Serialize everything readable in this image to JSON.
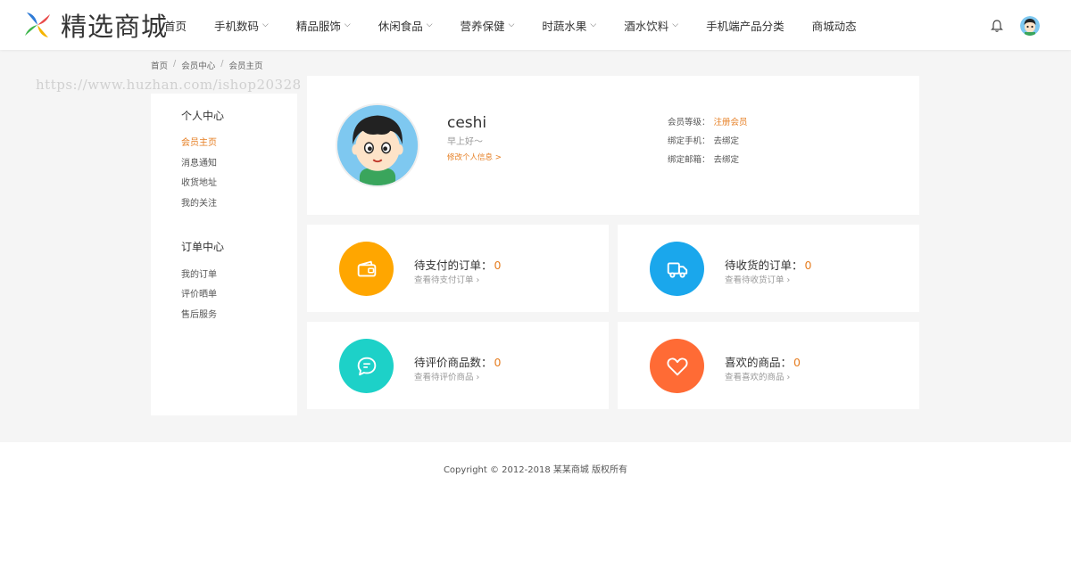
{
  "header": {
    "logo_text": "精选商城",
    "nav": [
      {
        "label": "首页",
        "has_dropdown": false
      },
      {
        "label": "手机数码",
        "has_dropdown": true
      },
      {
        "label": "精品服饰",
        "has_dropdown": true
      },
      {
        "label": "休闲食品",
        "has_dropdown": true
      },
      {
        "label": "营养保健",
        "has_dropdown": true
      },
      {
        "label": "时蔬水果",
        "has_dropdown": true
      },
      {
        "label": "酒水饮料",
        "has_dropdown": true
      },
      {
        "label": "手机端产品分类",
        "has_dropdown": false
      },
      {
        "label": "商城动态",
        "has_dropdown": false
      }
    ],
    "chevron": "⌵"
  },
  "breadcrumb": [
    "首页",
    "会员中心",
    "会员主页"
  ],
  "breadcrumb_sep": "/",
  "watermark": "https://www.huzhan.com/ishop20328",
  "sidebar": {
    "groups": [
      {
        "title": "个人中心",
        "items": [
          "会员主页",
          "消息通知",
          "收货地址",
          "我的关注"
        ]
      },
      {
        "title": "订单中心",
        "items": [
          "我的订单",
          "评价晒单",
          "售后服务"
        ]
      }
    ]
  },
  "profile": {
    "name": "ceshi",
    "greeting": "早上好～",
    "edit_link": "修改个人信息 >",
    "level_label": "会员等级：",
    "level_value": "注册会员",
    "phone_label": "绑定手机：",
    "phone_value": "去绑定",
    "email_label": "绑定邮箱：",
    "email_value": "去绑定"
  },
  "stats": [
    {
      "title": "待支付的订单：",
      "count": "0",
      "link": "查看待支付订单",
      "icon": "wallet-icon",
      "color": "#ffa600"
    },
    {
      "title": "待收货的订单：",
      "count": "0",
      "link": "查看待收货订单",
      "icon": "truck-icon",
      "color": "#1aa7ec"
    },
    {
      "title": "待评价商品数：",
      "count": "0",
      "link": "查看待评价商品",
      "icon": "comment-icon",
      "color": "#1dd1c8"
    },
    {
      "title": "喜欢的商品：",
      "count": "0",
      "link": "查看喜欢的商品",
      "icon": "heart-icon",
      "color": "#ff6b35"
    }
  ],
  "footer": {
    "copyright": "Copyright © 2012-2018 某某商城 版权所有"
  },
  "colors": {
    "accent": "#e67e22",
    "background": "#f5f5f5"
  }
}
